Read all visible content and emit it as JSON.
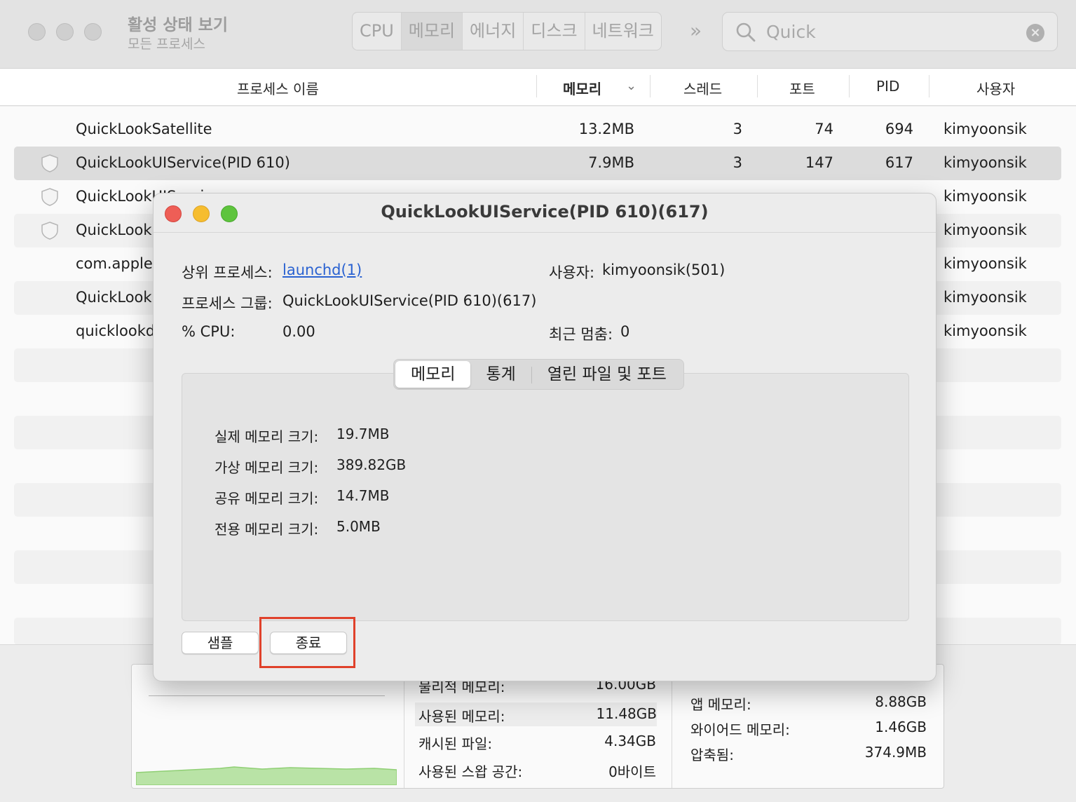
{
  "window": {
    "title": "활성 상태 보기",
    "subtitle": "모든 프로세스",
    "tabs": [
      "CPU",
      "메모리",
      "에너지",
      "디스크",
      "네트워크"
    ],
    "active_tab": "메모리",
    "overflow": "»",
    "search_value": "Quick"
  },
  "columns": {
    "name": "프로세스 이름",
    "memory": "메모리",
    "threads": "스레드",
    "ports": "포트",
    "pid": "PID",
    "user": "사용자"
  },
  "rows": [
    {
      "name": "QuickLookSatellite",
      "memory": "13.2MB",
      "threads": "3",
      "ports": "74",
      "pid": "694",
      "user": "kimyoonsik"
    },
    {
      "name": "QuickLookUIService(PID 610)",
      "memory": "7.9MB",
      "threads": "3",
      "ports": "147",
      "pid": "617",
      "user": "kimyoonsik"
    },
    {
      "name": "QuickLookUIServic",
      "user": "kimyoonsik"
    },
    {
      "name": "QuickLook",
      "user": "kimyoonsik"
    },
    {
      "name": "com.apple",
      "user": "kimyoonsik"
    },
    {
      "name": "QuickLook",
      "user": "kimyoonsik"
    },
    {
      "name": "quicklookd",
      "user": "kimyoonsik"
    }
  ],
  "memory_panel": {
    "physical_label": "물리적 메모리:",
    "physical_value": "16.00GB",
    "used_label": "사용된 메모리:",
    "used_value": "11.48GB",
    "cached_label": "캐시된 파일:",
    "cached_value": "4.34GB",
    "swap_label": "사용된 스왑 공간:",
    "swap_value": "0바이트",
    "app_label": "앱 메모리:",
    "app_value": "8.88GB",
    "wired_label": "와이어드 메모리:",
    "wired_value": "1.46GB",
    "compressed_label": "압축됨:",
    "compressed_value": "374.9MB"
  },
  "dialog": {
    "title": "QuickLookUIService(PID 610)(617)",
    "parent_label": "상위 프로세스:",
    "parent_value": "launchd(1)",
    "user_label": "사용자:",
    "user_value": "kimyoonsik(501)",
    "group_label": "프로세스 그룹:",
    "group_value": "QuickLookUIService(PID 610)(617)",
    "cpu_label": "% CPU:",
    "cpu_value": "0.00",
    "hangs_label": "최근 멈춤:",
    "hangs_value": "0",
    "tabs": [
      "메모리",
      "통계",
      "열린 파일 및 포트"
    ],
    "memory": [
      {
        "label": "실제 메모리 크기:",
        "value": "19.7MB"
      },
      {
        "label": "가상 메모리 크기:",
        "value": "389.82GB"
      },
      {
        "label": "공유 메모리 크기:",
        "value": "14.7MB"
      },
      {
        "label": "전용 메모리 크기:",
        "value": "5.0MB"
      }
    ],
    "sample_button": "샘플",
    "quit_button": "종료"
  },
  "colors": {
    "link": "#2a62d1",
    "highlight": "#e0412b",
    "close": "#ee5e56",
    "minimize": "#f6bd2f",
    "zoom": "#5ec43d"
  }
}
